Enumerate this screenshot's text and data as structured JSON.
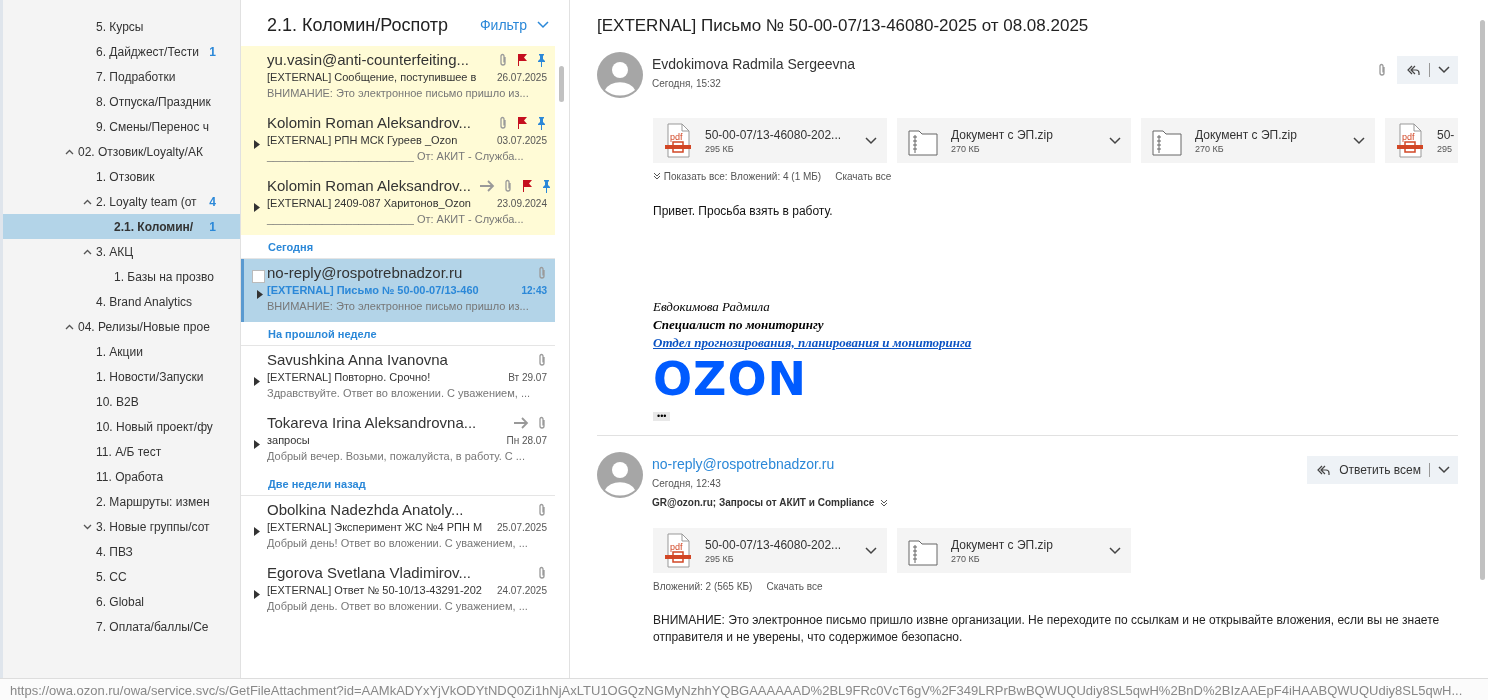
{
  "sidebar": {
    "items_above": [
      {
        "label": "5. Курсы"
      },
      {
        "label": "6. Дайджест/Тести",
        "count": "1"
      },
      {
        "label": "7. Подработки"
      },
      {
        "label": "8. Отпуска/Праздник"
      },
      {
        "label": "9. Смены/Перенос ч"
      }
    ],
    "folders": [
      {
        "label": "02. Отзовик/Loyalty/АК",
        "expanded": true,
        "selected": false,
        "children": [
          {
            "label": "1. Отзовик",
            "selected": false
          },
          {
            "label": "2. Loyalty team (от",
            "count": "4",
            "expanded": true,
            "selected": false,
            "children": [
              {
                "label": "2.1. Коломин/",
                "count": "1",
                "selected": true
              }
            ]
          },
          {
            "label": "3. АКЦ",
            "expanded": true,
            "selected": false,
            "children": [
              {
                "label": "1. Базы на прозво",
                "selected": false
              }
            ]
          },
          {
            "label": "4. Brand Analytics",
            "selected": false
          }
        ]
      },
      {
        "label": "04. Релизы/Новые прое",
        "expanded": true,
        "selected": false,
        "children": [
          {
            "label": "1. Акции",
            "selected": false
          },
          {
            "label": "1. Новости/Запуски",
            "selected": false
          },
          {
            "label": "10. B2B",
            "selected": false
          },
          {
            "label": "10. Новый проект/фу",
            "selected": false
          },
          {
            "label": "11. А/Б тест",
            "selected": false
          },
          {
            "label": "11. Оработа",
            "selected": false
          },
          {
            "label": "2. Маршруты: измен",
            "selected": false
          },
          {
            "label": "3. Новые группы/сот",
            "expanded": false,
            "selected": false
          },
          {
            "label": "4. ПВЗ",
            "selected": false
          },
          {
            "label": "5. CC",
            "selected": false
          },
          {
            "label": "6. Global",
            "selected": false
          },
          {
            "label": "7. Оплата/баллы/Се",
            "selected": false
          }
        ]
      }
    ]
  },
  "message_list": {
    "title": "2.1. Коломин/Роспотр",
    "filter": "Фильтр",
    "sections": [
      {
        "messages": [
          {
            "sender": "yu.vasin@anti-counterfeiting...",
            "subject": "[EXTERNAL] Сообщение, поступившее в",
            "date": "26.07.2025",
            "preview": "ВНИМАНИЕ: Это электронное письмо пришло из...",
            "thread": false,
            "forwarded": false,
            "attachment": true,
            "flagged": true,
            "pinned": true,
            "unread": false,
            "selected": false
          },
          {
            "sender": "Kolomin Roman Aleksandrov...",
            "subject": "[EXTERNAL] РПН МСК Гуреев _Ozon",
            "date": "03.07.2025",
            "preview": "________________________ От: АКИТ - Служба...",
            "thread": true,
            "forwarded": false,
            "attachment": true,
            "flagged": true,
            "pinned": true,
            "unread": false,
            "selected": false
          },
          {
            "sender": "Kolomin Roman Aleksandrov...",
            "subject": "[EXTERNAL] 2409-087 Харитонов_Ozon",
            "date": "23.09.2024",
            "preview": "________________________ От: АКИТ - Служба...",
            "thread": true,
            "forwarded": true,
            "attachment": true,
            "flagged": true,
            "pinned": true,
            "unread": false,
            "selected": false
          }
        ]
      },
      {
        "header": "Сегодня",
        "messages": [
          {
            "sender": "no-reply@rospotrebnadzor.ru",
            "subject": "[EXTERNAL] Письмо № 50-00-07/13-460",
            "date": "12:43",
            "preview": "ВНИМАНИЕ: Это электронное письмо пришло из...",
            "thread": true,
            "forwarded": false,
            "attachment": true,
            "flagged": false,
            "pinned": false,
            "unread": true,
            "selected": true
          }
        ]
      },
      {
        "header": "На прошлой неделе",
        "messages": [
          {
            "sender": "Savushkina Anna Ivanovna",
            "subject": "[EXTERNAL] Повторно. Срочно!",
            "date": "Вт 29.07",
            "preview": "Здравствуйте. Ответ во вложении. С уважением, ...",
            "thread": true,
            "forwarded": false,
            "attachment": true,
            "flagged": false,
            "pinned": false,
            "unread": false,
            "selected": false
          },
          {
            "sender": "Tokareva Irina Aleksandrovna...",
            "subject": "запросы",
            "date": "Пн 28.07",
            "preview": "Добрый вечер. Возьми, пожалуйста, в работу. С ...",
            "thread": true,
            "forwarded": true,
            "attachment": true,
            "flagged": false,
            "pinned": false,
            "unread": false,
            "selected": false
          }
        ]
      },
      {
        "header": "Две недели назад",
        "messages": [
          {
            "sender": "Obolkina Nadezhda Anatoly...",
            "subject": "[EXTERNAL] Эксперимент ЖС №4 РПН М",
            "date": "25.07.2025",
            "preview": "Добрый день! Ответ во вложении. С уважением, ...",
            "thread": true,
            "forwarded": false,
            "attachment": true,
            "flagged": false,
            "pinned": false,
            "unread": false,
            "selected": false
          },
          {
            "sender": "Egorova Svetlana Vladimirov...",
            "subject": "[EXTERNAL] Ответ № 50-10/13-43291-202",
            "date": "24.07.2025",
            "preview": "Добрый день. Ответ во вложении. С уважением, ...",
            "thread": true,
            "forwarded": false,
            "attachment": true,
            "flagged": false,
            "pinned": false,
            "unread": false,
            "selected": false
          }
        ]
      }
    ]
  },
  "reading_pane": {
    "subject": "[EXTERNAL] Письмо № 50-00-07/13-46080-2025 от 08.08.2025",
    "messages": [
      {
        "sender": "Evdokimova Radmila Sergeevna",
        "sender_link": false,
        "time": "Сегодня, 15:32",
        "attachment": true,
        "attachments": [
          {
            "kind": "pdf",
            "name": "50-00-07/13-46080-202...",
            "size": "295 КБ"
          },
          {
            "kind": "zip",
            "name": "Документ с ЭП.zip",
            "size": "270 КБ"
          },
          {
            "kind": "zip",
            "name": "Документ с ЭП.zip",
            "size": "270 КБ"
          },
          {
            "kind": "pdf",
            "name": "50-",
            "size": "295",
            "clipped": true
          }
        ],
        "attachments_summary": "Показать все: Вложений: 4 (1 МБ)",
        "show_all": true,
        "download_all": "Скачать все",
        "body": "Привет. Просьба взять в работу.",
        "signature": {
          "name": "Евдокимова Радмила",
          "position": "Специалист по мониторингу",
          "department": "Отдел прогнозирования, планирования и мониторинга",
          "logo": "OZON"
        },
        "more": "•••"
      },
      {
        "sender": "no-reply@rospotrebnadzor.ru",
        "sender_link": true,
        "time": "Сегодня, 12:43",
        "recipients": "GR@ozon.ru; Запросы от АКИТ и Compliance",
        "reply_all": "Ответить всем",
        "attachments": [
          {
            "kind": "pdf",
            "name": "50-00-07/13-46080-202...",
            "size": "295 КБ"
          },
          {
            "kind": "zip",
            "name": "Документ с ЭП.zip",
            "size": "270 КБ"
          }
        ],
        "attachments_summary": "Вложений: 2 (565 КБ)",
        "show_all": false,
        "download_all": "Скачать все",
        "body": "ВНИМАНИЕ: Это электронное письмо пришло извне организации. Не переходите по ссылкам и не открывайте вложения, если вы не знаете отправителя и не уверены, что содержимое безопасно."
      }
    ]
  },
  "status_bar": {
    "url": "https://owa.ozon.ru/owa/service.svc/s/GetFileAttachment?id=AAMkADYxYjVkODYtNDQ0Zi1hNjAxLTU1OGQzNGMyNzhhYQBGAAAAAAD%2BL9FRc0VcT6gV%2F349LRPrBwBQWUQUdiy8SL5qwH%2BnD%2BIzAAEpF4iHAABQWUQUdiy8SL5qwH..."
  }
}
